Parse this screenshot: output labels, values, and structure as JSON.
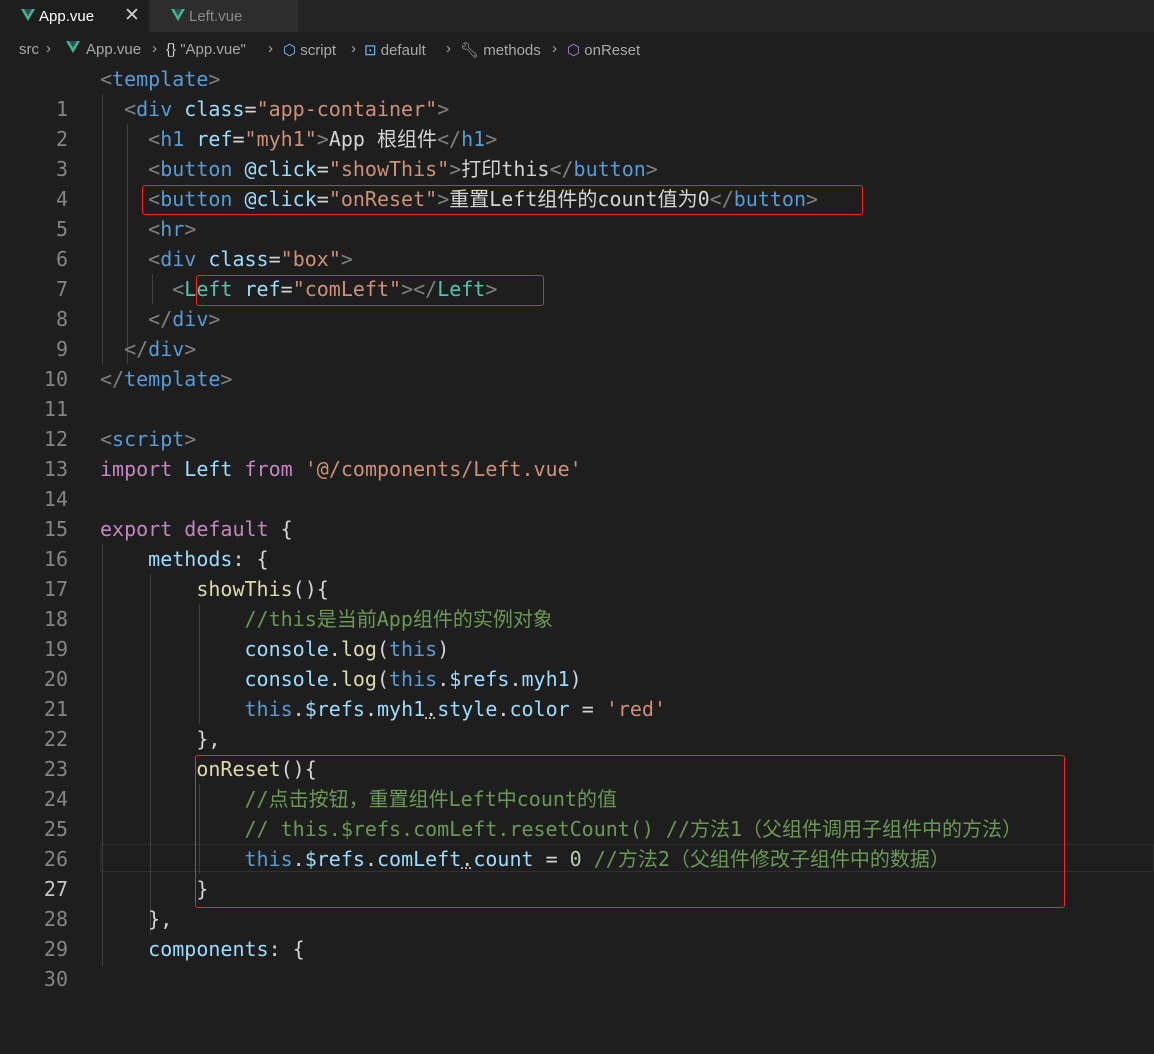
{
  "tabs": [
    {
      "label": "App.vue",
      "active": true,
      "close": "✕"
    },
    {
      "label": "Left.vue",
      "active": false
    }
  ],
  "breadcrumb": {
    "src": "src",
    "file": "App.vue",
    "obj": "\"App.vue\"",
    "script": "script",
    "default": "default",
    "methods": "methods",
    "method": "onReset"
  },
  "colors": {
    "highlight_border": "#ff2020",
    "vue_green": "#41b883",
    "background": "#1e1e1e"
  },
  "lines": [
    {
      "n": "1"
    },
    {
      "n": "2"
    },
    {
      "n": "3"
    },
    {
      "n": "4"
    },
    {
      "n": "5"
    },
    {
      "n": "6"
    },
    {
      "n": "7"
    },
    {
      "n": "8"
    },
    {
      "n": "9"
    },
    {
      "n": "10"
    },
    {
      "n": "11"
    },
    {
      "n": "12"
    },
    {
      "n": "13"
    },
    {
      "n": "14"
    },
    {
      "n": "15"
    },
    {
      "n": "16"
    },
    {
      "n": "17"
    },
    {
      "n": "18"
    },
    {
      "n": "19"
    },
    {
      "n": "20"
    },
    {
      "n": "21"
    },
    {
      "n": "22"
    },
    {
      "n": "23"
    },
    {
      "n": "24"
    },
    {
      "n": "25"
    },
    {
      "n": "26"
    },
    {
      "n": "27"
    },
    {
      "n": "28"
    },
    {
      "n": "29"
    },
    {
      "n": "30"
    }
  ],
  "code": {
    "l1": [
      "<",
      "template",
      ">"
    ],
    "l2": [
      "  <",
      "div",
      " ",
      "class",
      "=",
      "\"app-container\"",
      ">"
    ],
    "l3": [
      "    <",
      "h1",
      " ",
      "ref",
      "=",
      "\"myh1\"",
      ">",
      "App 根组件",
      "</",
      "h1",
      ">"
    ],
    "l4": [
      "    <",
      "button",
      " ",
      "@click",
      "=",
      "\"showThis\"",
      ">",
      "打印this",
      "</",
      "button",
      ">"
    ],
    "l5": [
      "    <",
      "button",
      " ",
      "@click",
      "=",
      "\"onReset\"",
      ">",
      "重置Left组件的count值为0",
      "</",
      "button",
      ">"
    ],
    "l6": [
      "    <",
      "hr",
      ">"
    ],
    "l7": [
      "    <",
      "div",
      " ",
      "class",
      "=",
      "\"box\"",
      ">"
    ],
    "l8": [
      "      <",
      "Left",
      " ",
      "ref",
      "=",
      "\"comLeft\"",
      "></",
      "Left",
      ">"
    ],
    "l9": [
      "    </",
      "div",
      ">"
    ],
    "l10": [
      "  </",
      "div",
      ">"
    ],
    "l11": [
      "</",
      "template",
      ">"
    ],
    "l13": [
      "<",
      "script",
      ">"
    ],
    "l14": [
      "import",
      " ",
      "Left",
      " ",
      "from",
      " ",
      "'@/components/Left.vue'"
    ],
    "l16": [
      "export",
      " ",
      "default",
      " {"
    ],
    "l17": [
      "    ",
      "methods",
      ": {"
    ],
    "l18": [
      "        ",
      "showThis",
      "(){"
    ],
    "l19": [
      "            ",
      "//this是当前App组件的实例对象"
    ],
    "l20": [
      "            ",
      "console",
      ".",
      "log",
      "(",
      "this",
      ")"
    ],
    "l21": [
      "            ",
      "console",
      ".",
      "log",
      "(",
      "this",
      ".",
      "$refs",
      ".",
      "myh1",
      ")"
    ],
    "l22": [
      "            ",
      "this",
      ".",
      "$refs",
      ".",
      "myh1",
      ".",
      "style",
      ".",
      "color",
      " = ",
      "'red'"
    ],
    "l23": [
      "        },"
    ],
    "l24": [
      "        ",
      "onReset",
      "(){"
    ],
    "l25": [
      "            ",
      "//点击按钮，重置组件Left中count的值"
    ],
    "l26": [
      "            ",
      "// this.$refs.comLeft.resetCount() //方法1（父组件调用子组件中的方法）"
    ],
    "l27": [
      "            ",
      "this",
      ".",
      "$refs",
      ".",
      "comLeft",
      ".",
      "count",
      " = ",
      "0",
      " ",
      "//方法2（父组件修改子组件中的数据）"
    ],
    "l28": [
      "        }"
    ],
    "l29": [
      "    },"
    ],
    "l30": [
      "    ",
      "components",
      ": {"
    ]
  }
}
